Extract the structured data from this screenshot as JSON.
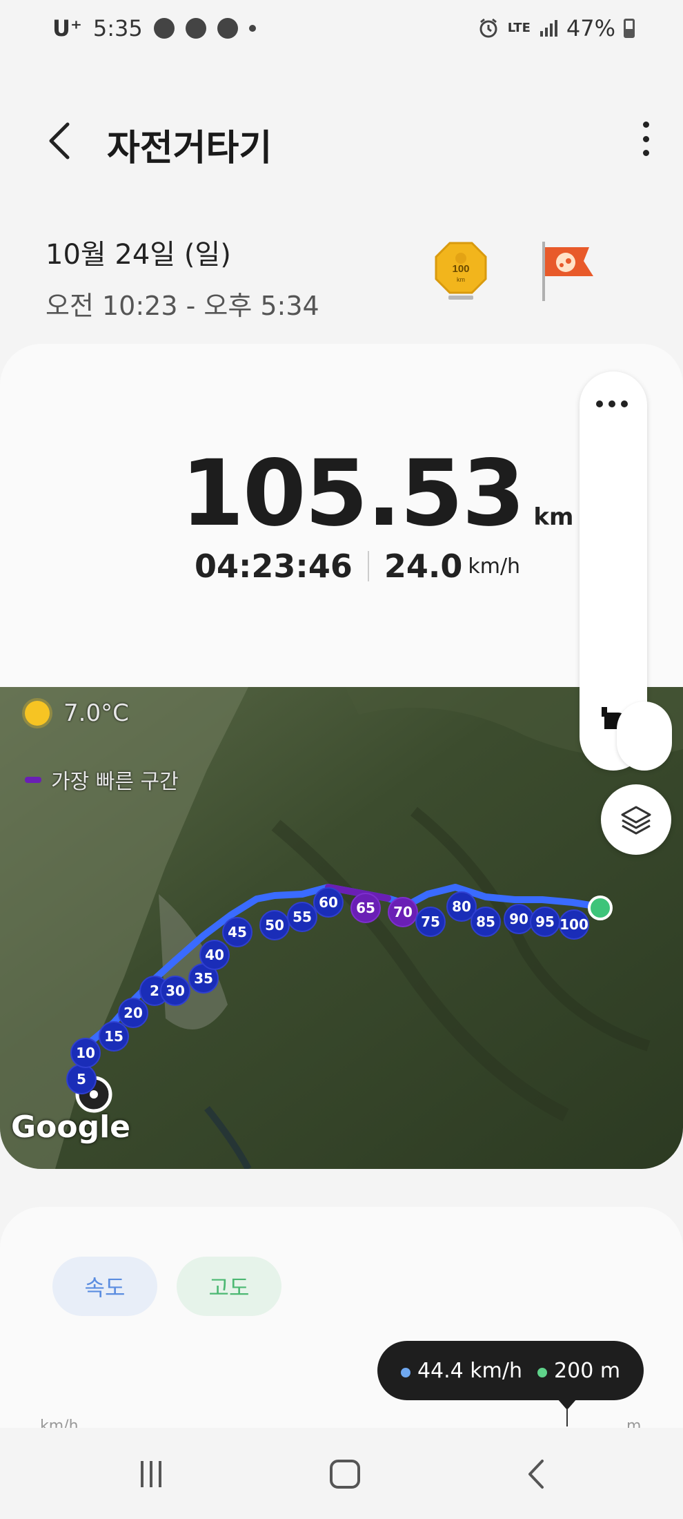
{
  "status_bar": {
    "carrier": "U⁺",
    "time": "5:35",
    "network": "LTE",
    "battery": "47%"
  },
  "header": {
    "title": "자전거타기"
  },
  "session": {
    "date": "10월 24일 (일)",
    "time_range": "오전 10:23 - 오후 5:34",
    "badge_distance": "100",
    "badge_unit": "km"
  },
  "summary": {
    "distance": "105.53",
    "distance_unit": "km",
    "duration": "04:23:46",
    "avg_speed": "24.0",
    "speed_unit": "km/h"
  },
  "map": {
    "weather_temp": "7.0°C",
    "legend_label": "가장 빠른 구간",
    "legend_color": "#6a1fb5",
    "route_color": "#1a2db8",
    "attribution": "Google",
    "km_markers": [
      {
        "label": "5",
        "fast": false
      },
      {
        "label": "10",
        "fast": false
      },
      {
        "label": "15",
        "fast": false
      },
      {
        "label": "20",
        "fast": false
      },
      {
        "label": "2",
        "fast": false
      },
      {
        "label": "30",
        "fast": false
      },
      {
        "label": "35",
        "fast": false
      },
      {
        "label": "40",
        "fast": false
      },
      {
        "label": "45",
        "fast": false
      },
      {
        "label": "50",
        "fast": false
      },
      {
        "label": "55",
        "fast": false
      },
      {
        "label": "60",
        "fast": false
      },
      {
        "label": "65",
        "fast": true
      },
      {
        "label": "70",
        "fast": true
      },
      {
        "label": "75",
        "fast": false
      },
      {
        "label": "80",
        "fast": false
      },
      {
        "label": "85",
        "fast": false
      },
      {
        "label": "90",
        "fast": false
      },
      {
        "label": "95",
        "fast": false
      },
      {
        "label": "100",
        "fast": false
      }
    ]
  },
  "chart": {
    "tab_speed": "속도",
    "tab_altitude": "고도",
    "axis_left_unit": "km/h",
    "axis_right_unit": "m",
    "tooltip_speed": "44.4 km/h",
    "tooltip_altitude": "200 m",
    "speed_color": "#6fa8f0",
    "altitude_color": "#5fd38a"
  }
}
